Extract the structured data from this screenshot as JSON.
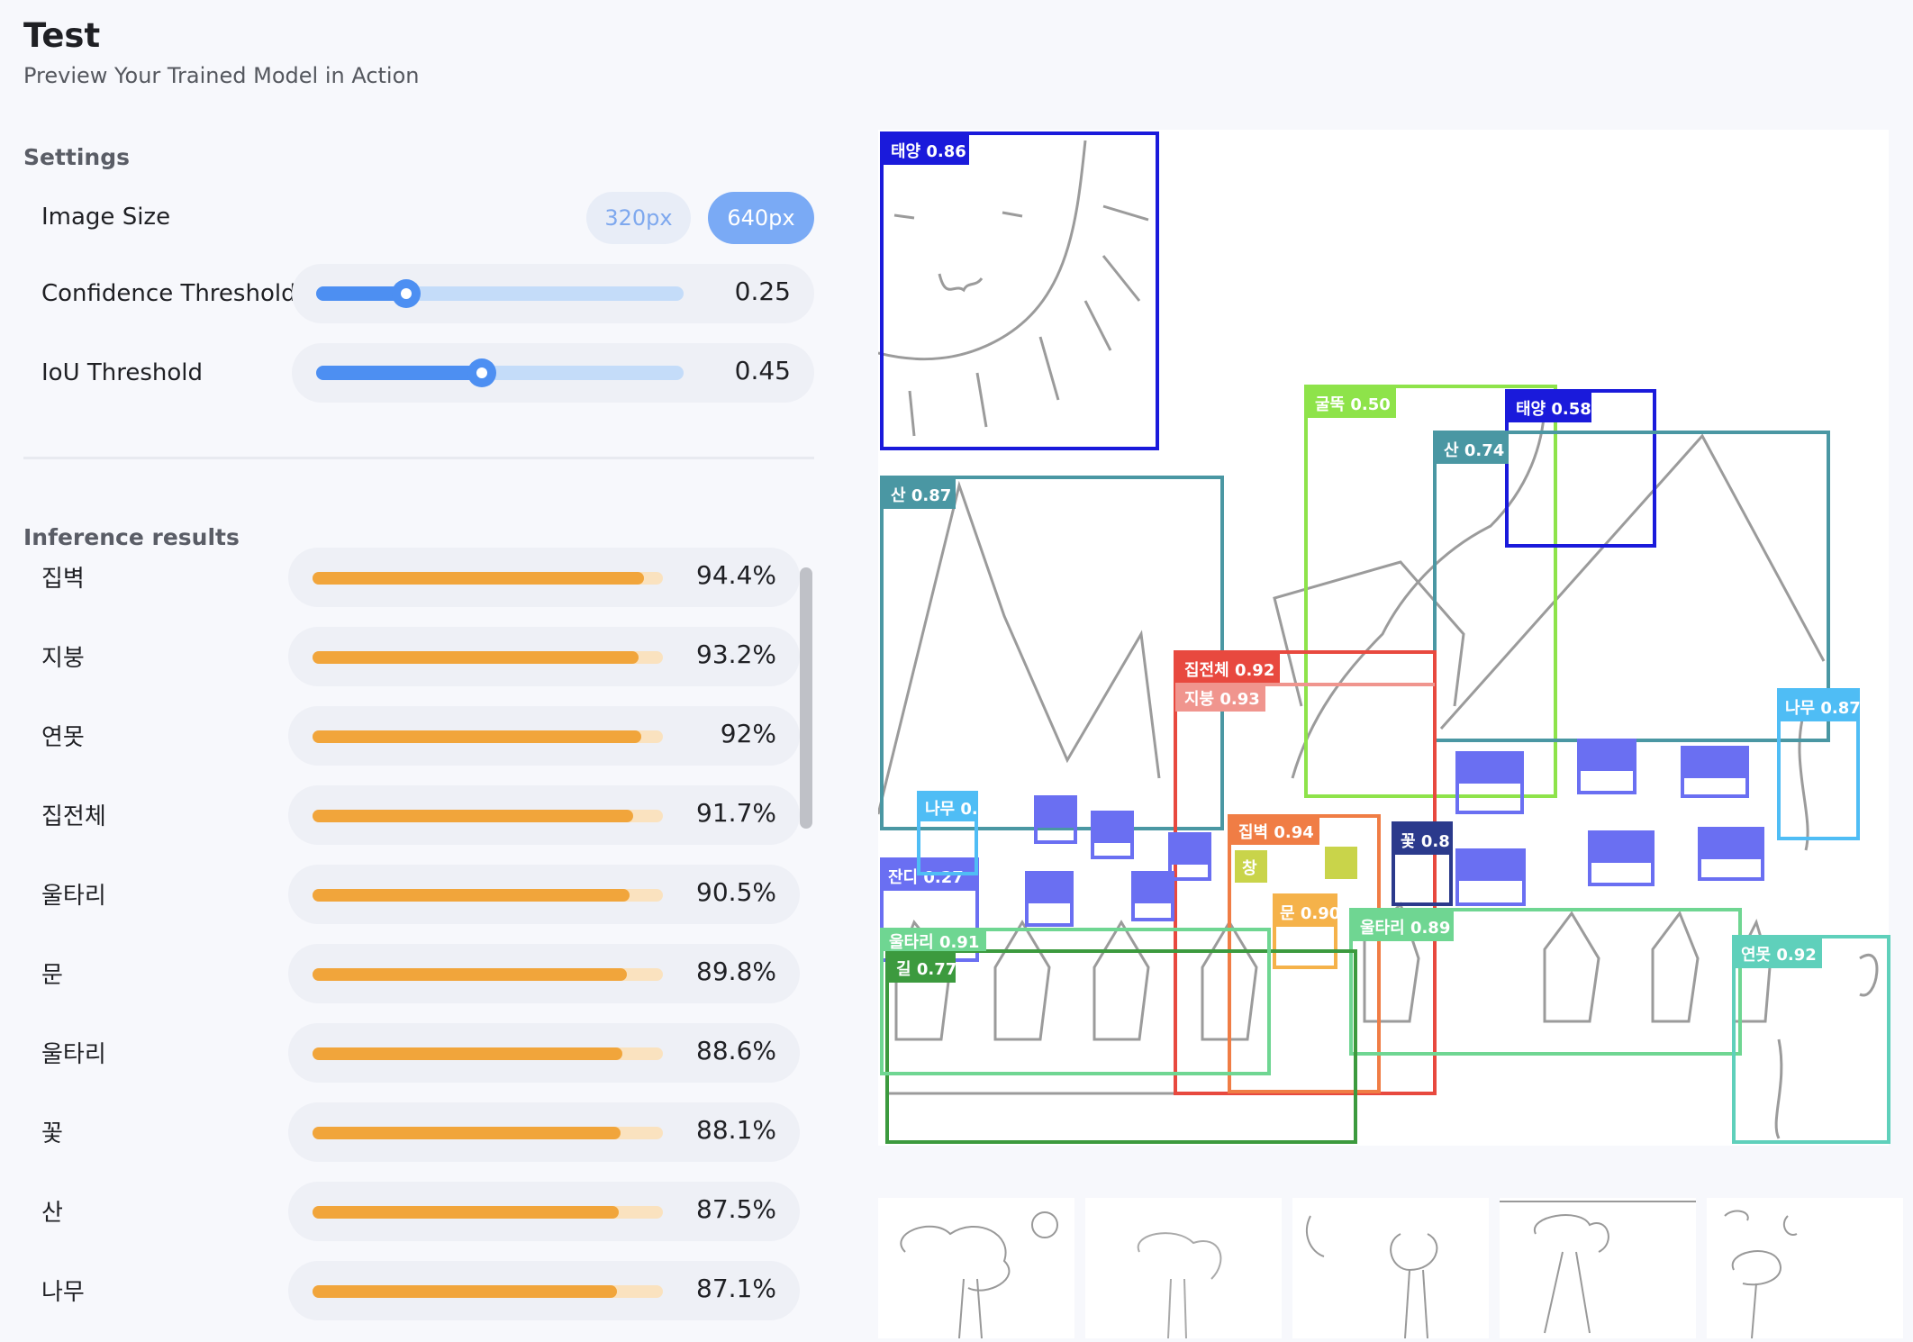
{
  "header": {
    "title": "Test",
    "subtitle": "Preview Your Trained Model in Action"
  },
  "settings": {
    "section_title": "Settings",
    "image_size": {
      "label": "Image Size",
      "options": [
        "320px",
        "640px"
      ],
      "selected": "640px"
    },
    "confidence": {
      "label": "Confidence Threshold",
      "value": "0.25",
      "fraction": 0.25
    },
    "iou": {
      "label": "IoU Threshold",
      "value": "0.45",
      "fraction": 0.45
    }
  },
  "results": {
    "section_title": "Inference results",
    "items": [
      {
        "label": "집벽",
        "value": "94.4%",
        "fraction": 0.944
      },
      {
        "label": "지붕",
        "value": "93.2%",
        "fraction": 0.932
      },
      {
        "label": "연못",
        "value": "92%",
        "fraction": 0.92
      },
      {
        "label": "집전체",
        "value": "91.7%",
        "fraction": 0.917
      },
      {
        "label": "울타리",
        "value": "90.5%",
        "fraction": 0.905
      },
      {
        "label": "문",
        "value": "89.8%",
        "fraction": 0.898
      },
      {
        "label": "울타리",
        "value": "88.6%",
        "fraction": 0.886
      },
      {
        "label": "꽃",
        "value": "88.1%",
        "fraction": 0.881
      },
      {
        "label": "산",
        "value": "87.5%",
        "fraction": 0.875
      },
      {
        "label": "나무",
        "value": "87.1%",
        "fraction": 0.871
      }
    ]
  },
  "detections": [
    {
      "label": "태양 0.86",
      "color": "#1a1adb"
    },
    {
      "label": "산 0.87",
      "color": "#4a97a3"
    },
    {
      "label": "굴뚝 0.50",
      "color": "#8ee34a"
    },
    {
      "label": "태양 0.58",
      "color": "#1a1adb"
    },
    {
      "label": "산 0.74",
      "color": "#4a97a3"
    },
    {
      "label": "집전체 0.92",
      "color": "#e8493f"
    },
    {
      "label": "지붕 0.93",
      "color": "#f0958e"
    },
    {
      "label": "나무 0.87",
      "color": "#4fbdf5"
    },
    {
      "label": "집벽 0.94",
      "color": "#f07d45"
    },
    {
      "label": "꽃 0.8",
      "color": "#2b3a8c"
    },
    {
      "label": "문 0.90",
      "color": "#f5b24a"
    },
    {
      "label": "울타리 0.89",
      "color": "#6fd692"
    },
    {
      "label": "잔디 0.27",
      "color": "#6a6ff2"
    },
    {
      "label": "나무 0.",
      "color": "#4fbdf5"
    },
    {
      "label": "길 0.77",
      "color": "#3c9a3e"
    },
    {
      "label": "울타리 0.91",
      "color": "#6fd692"
    },
    {
      "label": "연못 0.92",
      "color": "#5fd0bb"
    },
    {
      "label": "창",
      "color": "#c9d44a"
    }
  ],
  "thumbnails": [
    "thumb-1",
    "thumb-2",
    "thumb-3",
    "thumb-4",
    "thumb-5"
  ]
}
